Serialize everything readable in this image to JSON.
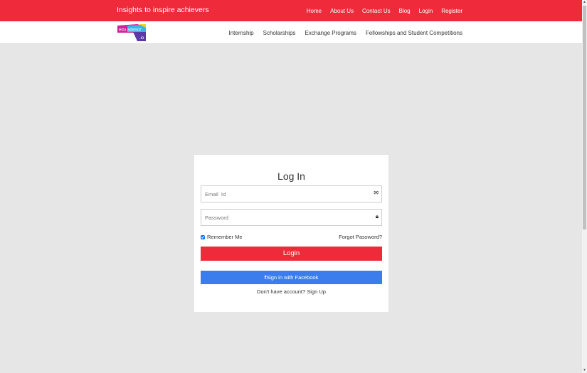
{
  "header": {
    "tagline": "Insights to inspire achievers",
    "top_nav": [
      "Home",
      "About Us",
      "Contact Us",
      "Blog",
      "Login",
      "Register"
    ]
  },
  "logo": {
    "text": "eduadvisor",
    "suffix": ".io"
  },
  "main_nav": [
    "Internship",
    "Scholarships",
    "Exchange Programs",
    "Fellowships and Student Competitions"
  ],
  "login_card": {
    "title": "Log In",
    "email_placeholder": "Email  Id",
    "password_placeholder": "Password",
    "remember_label": "Remember Me",
    "remember_checked": true,
    "forgot_label": "Forgot Password?",
    "login_button": "Login",
    "facebook_icon": "f",
    "facebook_button": "Sign in with Facebook",
    "signup_text": "Don't have account? Sign Up"
  },
  "colors": {
    "brand": "#ee2a3b",
    "facebook": "#3b7ded"
  }
}
